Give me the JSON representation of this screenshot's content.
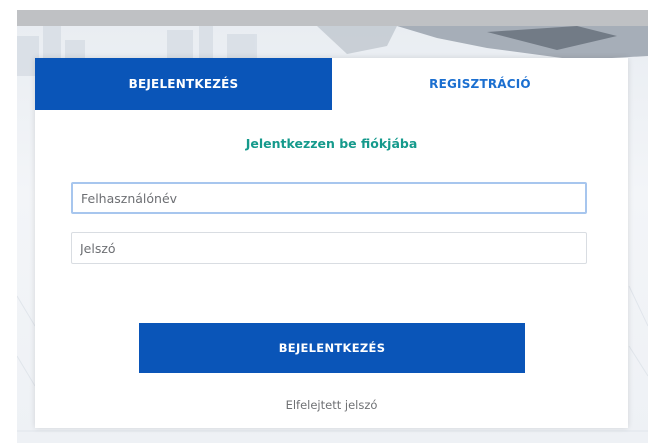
{
  "tabs": {
    "login_label": "BEJELENTKEZÉS",
    "register_label": "REGISZTRÁCIÓ"
  },
  "form": {
    "subtitle": "Jelentkezzen be fiókjába",
    "username_placeholder": "Felhasználónév",
    "password_placeholder": "Jelszó",
    "submit_label": "BEJELENTKEZÉS",
    "forgot_label": "Elfelejtett jelszó"
  },
  "colors": {
    "primary": "#0a55b8",
    "tab_inactive_text": "#1b6fd0",
    "subtitle": "#159a8c",
    "muted_text": "#6f7174"
  }
}
